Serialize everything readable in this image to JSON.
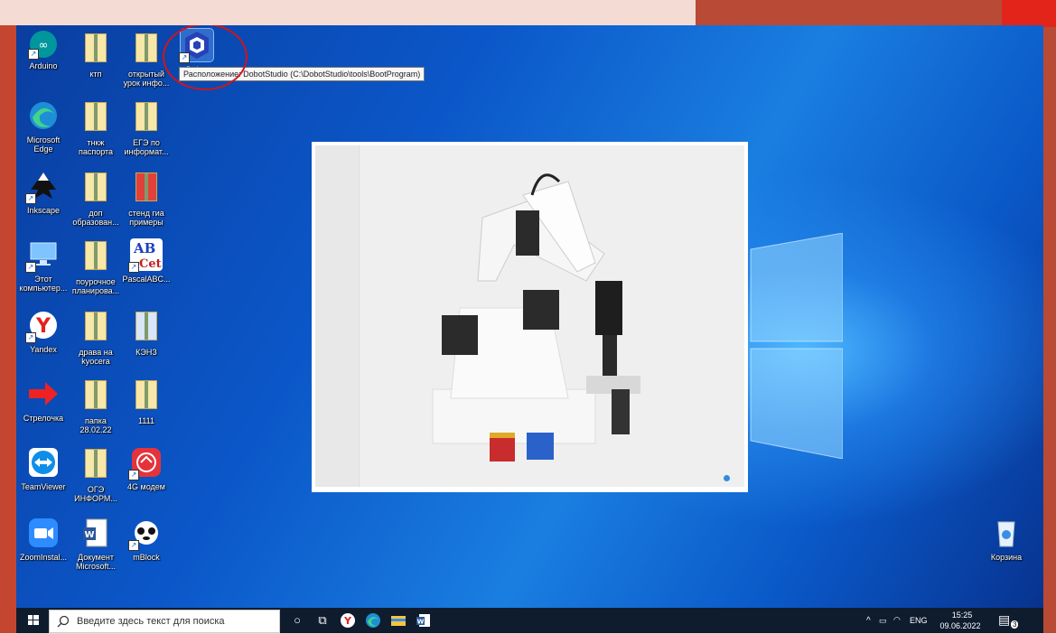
{
  "desktop": {
    "icons": [
      {
        "label": "Arduino",
        "icon": "arduino-icon"
      },
      {
        "label": "ктп",
        "icon": "folder-icon"
      },
      {
        "label": "открытый\nурок инфо...",
        "icon": "folder-icon"
      },
      {
        "label": "Dobot",
        "icon": "dobot-icon"
      },
      {
        "label": "Microsoft\nEdge",
        "icon": "edge-icon"
      },
      {
        "label": "тнкж\nпаспорта",
        "icon": "folder-icon"
      },
      {
        "label": "ЕГЭ по\nинформат...",
        "icon": "folder-icon"
      },
      {
        "label": "Inkscape",
        "icon": "inkscape-icon"
      },
      {
        "label": "доп\nобразован...",
        "icon": "folder-icon"
      },
      {
        "label": "стенд гиа\nпримеры",
        "icon": "folder-icon"
      },
      {
        "label": "Этот\nкомпьютер...",
        "icon": "computer-icon"
      },
      {
        "label": "поурочное\nпланирова...",
        "icon": "folder-icon"
      },
      {
        "label": "PascalABC...",
        "icon": "pascal-icon"
      },
      {
        "label": "Yandex",
        "icon": "yandex-icon"
      },
      {
        "label": "драва на\nkyocera",
        "icon": "folder-icon"
      },
      {
        "label": "КЭНЗ",
        "icon": "folder-icon"
      },
      {
        "label": "Стрелочка",
        "icon": "arrow-icon"
      },
      {
        "label": "папка\n28.02.22",
        "icon": "folder-icon"
      },
      {
        "label": "1111",
        "icon": "folder-icon"
      },
      {
        "label": "TeamViewer",
        "icon": "teamviewer-icon"
      },
      {
        "label": "ОГЭ\nИНФОРМ...",
        "icon": "folder-icon"
      },
      {
        "label": "4G модем",
        "icon": "modem-icon"
      },
      {
        "label": "ZoomInstal...",
        "icon": "zoom-icon"
      },
      {
        "label": "Документ\nMicrosoft...",
        "icon": "word-icon"
      },
      {
        "label": "mBlock",
        "icon": "mblock-icon"
      },
      {
        "label": "Корзина",
        "icon": "recycle-bin-icon"
      }
    ],
    "tooltip": "Расположение: DobotStudio (C:\\DobotStudio\\tools\\BootProgram)"
  },
  "taskbar": {
    "search_placeholder": "Введите здесь текст для поиска",
    "lang": "ENG",
    "time": "15:25",
    "date": "09.06.2022",
    "notifications": "3"
  },
  "colors": {
    "highlight_circle": "#d1141a",
    "taskbar_bg": "#0f1c2e",
    "slide_accent": "#b94a35"
  }
}
